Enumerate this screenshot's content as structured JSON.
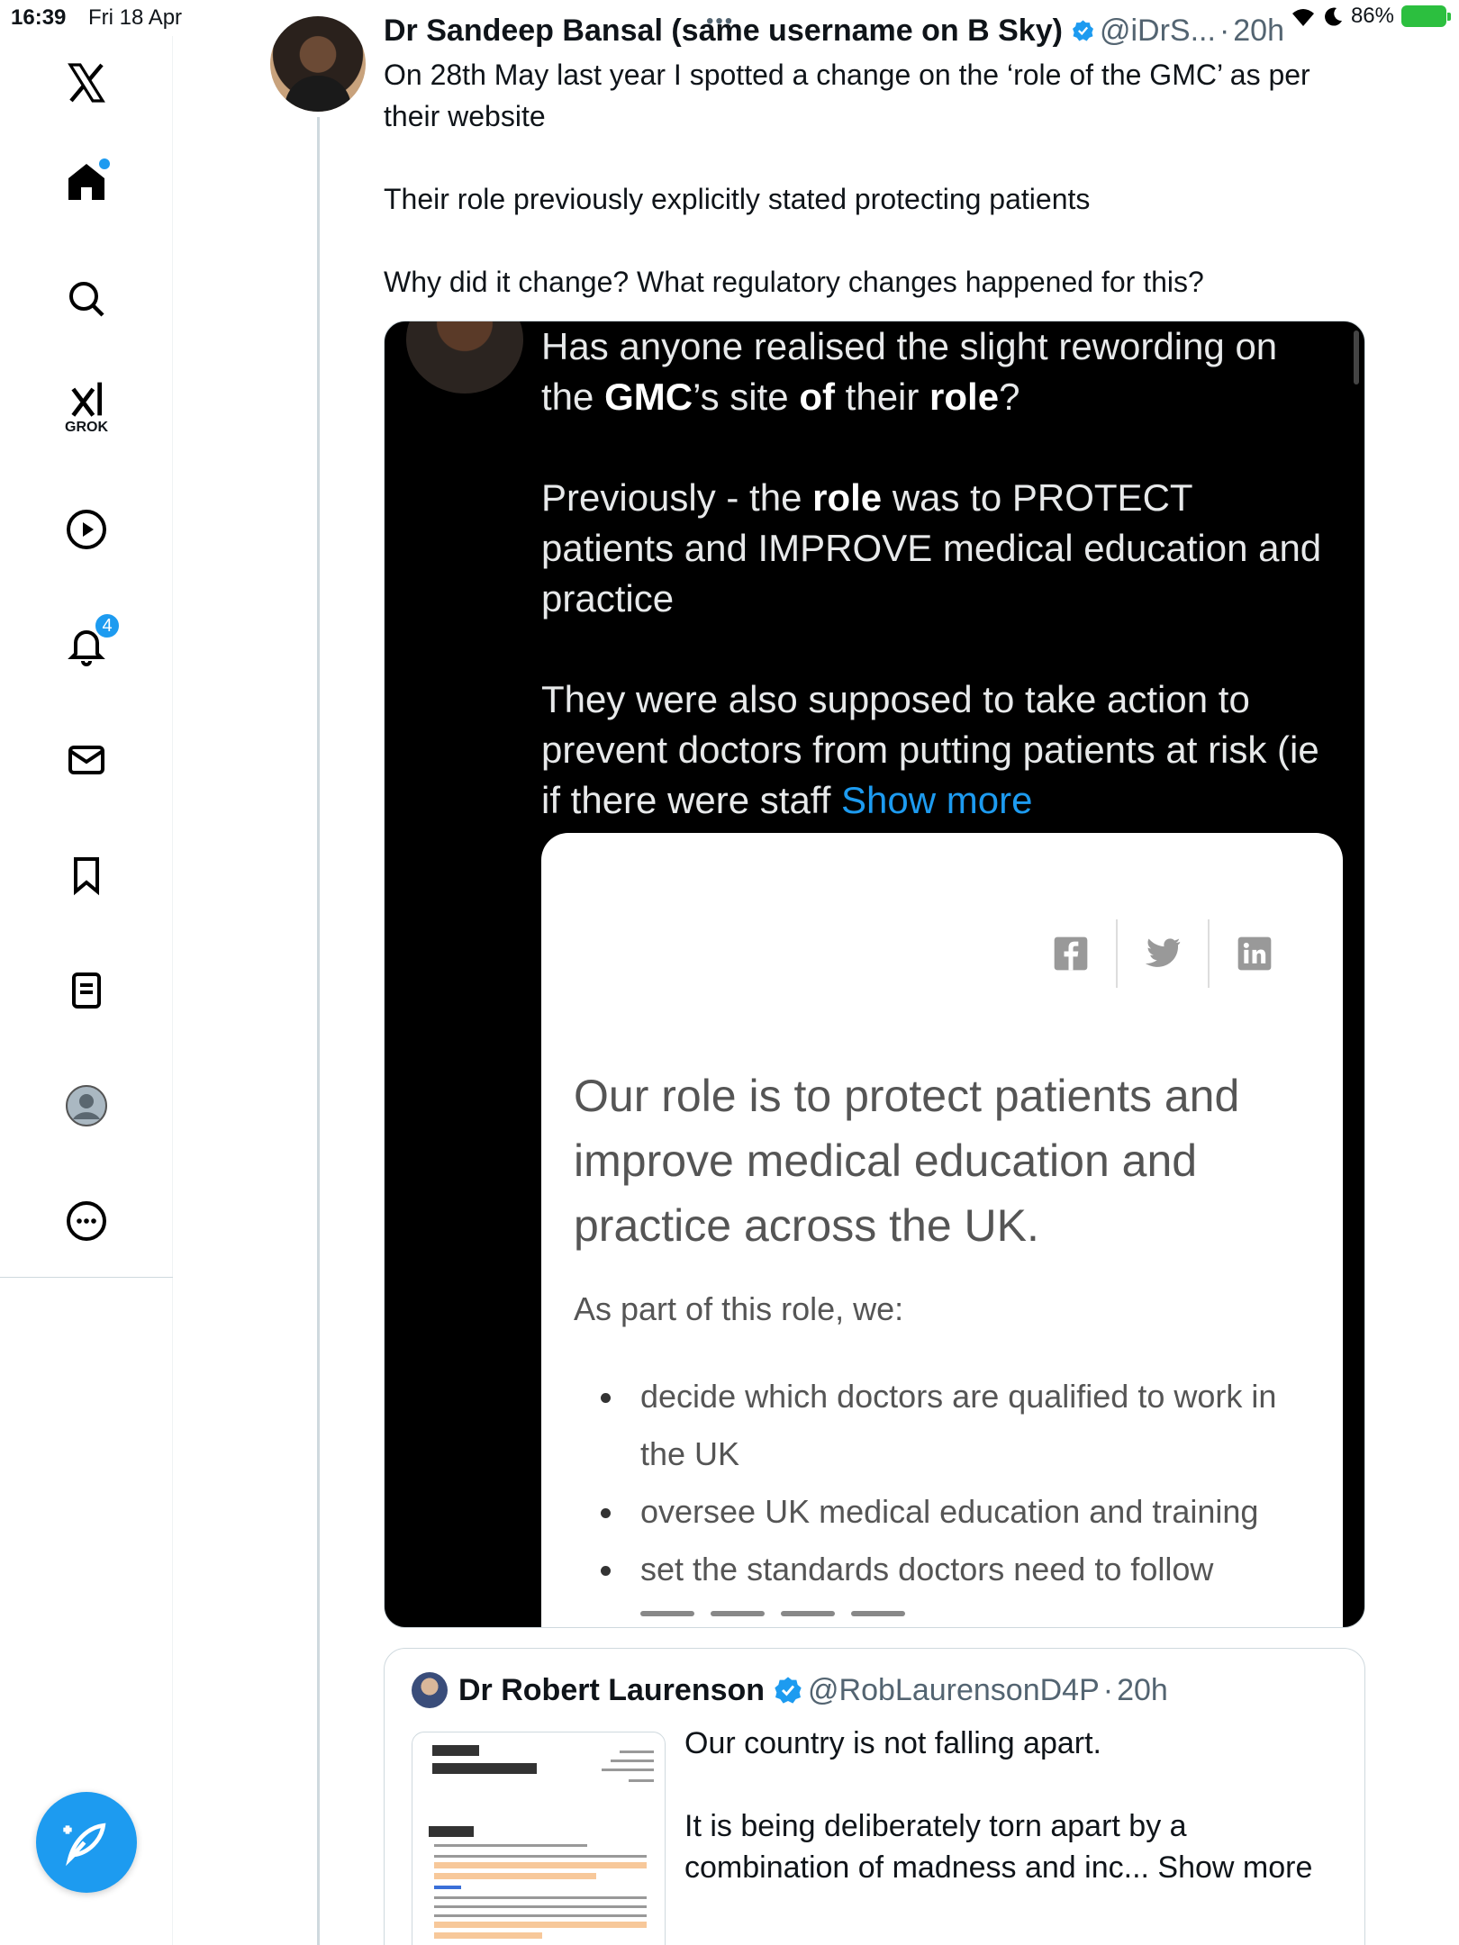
{
  "status_bar": {
    "time": "16:39",
    "date": "Fri 18 Apr",
    "battery": "86%"
  },
  "nav": {
    "notifications_count": "4",
    "grok_label": "GROK"
  },
  "tweet": {
    "author_name": "Dr Sandeep Bansal (same username on B Sky)",
    "handle": "@iDrS...",
    "dot": "·",
    "time": "20h",
    "paragraphs": [
      "On 28th May last year I spotted a change on the ‘role of the GMC’ as per their website",
      "Their role previously explicitly stated protecting patients",
      "Why did it change? What regulatory changes happened for this?"
    ]
  },
  "media": {
    "p1": {
      "a": "Has anyone realised the slight rewording on the ",
      "b1": "GMC",
      "c": "’s site ",
      "b2": "of",
      "d": " their ",
      "b3": "role",
      "e": "?"
    },
    "p2": {
      "a": "Previously - the ",
      "b": "role",
      "c": " was to PROTECT patients and IMPROVE medical education and practice"
    },
    "p3": "They were also supposed to take action to prevent doctors from putting patients at risk (ie if there were staff ",
    "show_more": "Show more",
    "gmc_card": {
      "heading": "Our role is to protect patients and improve medical education and practice across the UK.",
      "sub": "As part of this role, we:",
      "bullets": [
        "decide which doctors are qualified to work in the UK",
        "oversee UK medical education and training",
        "set the standards doctors need to follow"
      ]
    }
  },
  "quote": {
    "author_name": "Dr Robert Laurenson",
    "handle": "@RobLaurensonD4P",
    "dot": "·",
    "time": "20h",
    "p1": "Our country is not falling apart.",
    "p2": "It is being deliberately torn apart by a combination of madness and inc... Show more"
  },
  "colors": {
    "accent": "#1d9bf0",
    "text": "#0f1419",
    "secondary": "#536471",
    "battery": "#2cbf3f"
  },
  "icons": [
    "x-logo-icon",
    "home-icon",
    "search-icon",
    "grok-icon",
    "video-icon",
    "bell-icon",
    "mail-icon",
    "bookmark-icon",
    "lists-icon",
    "profile-icon",
    "more-icon",
    "compose-icon",
    "verified-icon",
    "facebook-icon",
    "twitter-icon",
    "linkedin-icon"
  ]
}
